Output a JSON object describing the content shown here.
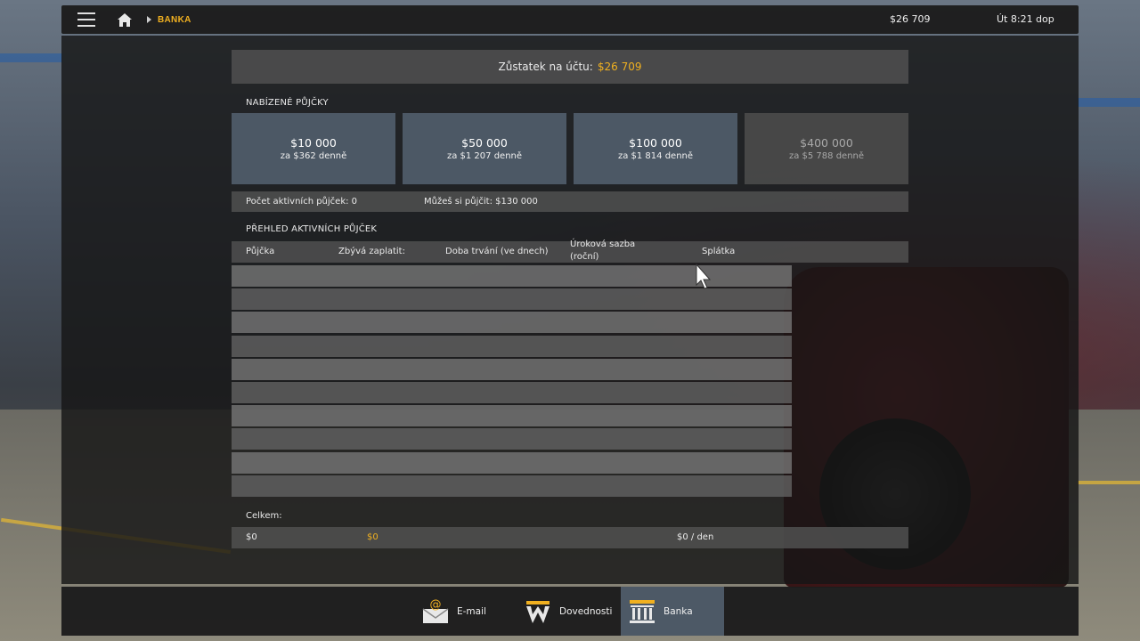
{
  "topbar": {
    "breadcrumb": "BANKA",
    "money": "$26 709",
    "time": "Út 8:21 dop"
  },
  "balance": {
    "label": "Zůstatek na účtu:",
    "amount": "$26 709"
  },
  "offers": {
    "title": "NABÍZENÉ PŮJČKY",
    "cards": [
      {
        "amount": "$10 000",
        "rate": "za $362 denně",
        "enabled": true
      },
      {
        "amount": "$50 000",
        "rate": "za $1 207 denně",
        "enabled": true
      },
      {
        "amount": "$100 000",
        "rate": "za $1 814 denně",
        "enabled": true
      },
      {
        "amount": "$400 000",
        "rate": "za $5 788 denně",
        "enabled": false
      }
    ]
  },
  "info": {
    "active_count": "Počet aktivních půjček: 0",
    "can_borrow": "Můžeš si půjčit: $130 000"
  },
  "overview": {
    "title": "PŘEHLED AKTIVNÍCH PŮJČEK",
    "columns": [
      "Půjčka",
      "Zbývá zaplatit:",
      "Doba trvání (ve dnech)",
      "Úroková sazba",
      "(roční)",
      "Splátka"
    ],
    "row_count": 10
  },
  "totals": {
    "label": "Celkem:",
    "loan": "$0",
    "remaining": "$0",
    "installment": "$0 / den"
  },
  "tabs": [
    {
      "label": "E-mail",
      "icon": "email-icon",
      "active": false
    },
    {
      "label": "Dovednosti",
      "icon": "skills-icon",
      "active": false
    },
    {
      "label": "Banka",
      "icon": "bank-icon",
      "active": true
    }
  ],
  "colors": {
    "accent": "#f0b020",
    "card": "#505d6a",
    "panel": "#161616"
  }
}
